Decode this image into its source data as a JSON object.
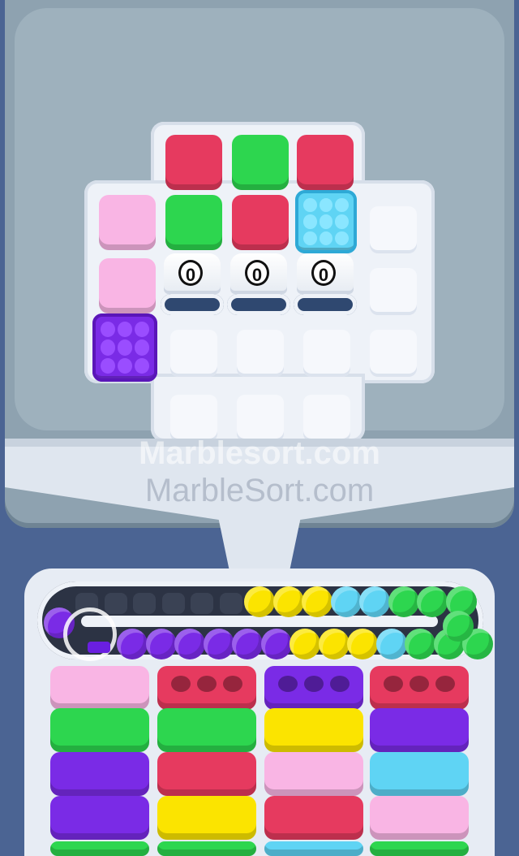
{
  "colors": {
    "red": "#e63a5f",
    "green": "#2dd64f",
    "pink": "#f9b5e4",
    "purple": "#7a2be6",
    "cyan": "#5fd4f4",
    "yellow": "#fbe400",
    "slot": "#f6f8fc"
  },
  "watermark": {
    "primary": "Marblesort.com",
    "secondary": "MarbleSort.com"
  },
  "cups": [
    {
      "count": "0"
    },
    {
      "count": "0"
    },
    {
      "count": "0"
    }
  ],
  "grid": {
    "blocks": [
      {
        "color": "red",
        "type": "block"
      },
      {
        "color": "green",
        "type": "block"
      },
      {
        "color": "red",
        "type": "block"
      },
      {
        "color": "pink",
        "type": "block"
      },
      {
        "color": "green",
        "type": "block"
      },
      {
        "color": "red",
        "type": "block"
      },
      {
        "color": "cyan",
        "type": "marble-block"
      },
      {
        "color": "pink",
        "type": "block"
      },
      {
        "color": "purple",
        "type": "marble-block"
      }
    ]
  },
  "conveyor": {
    "top_row": [
      "empty",
      "empty",
      "empty",
      "empty",
      "empty",
      "empty",
      "yellow",
      "yellow",
      "yellow",
      "cyan",
      "cyan",
      "green",
      "green",
      "green"
    ],
    "bottom_row": [
      "purple",
      "purple",
      "purple",
      "purple",
      "purple",
      "purple",
      "yellow",
      "yellow",
      "yellow",
      "cyan",
      "green",
      "green",
      "green"
    ],
    "left_marble": "purple"
  },
  "storage": {
    "columns": [
      [
        "pink",
        "green",
        "purple",
        "purple",
        "green"
      ],
      [
        "red",
        "green",
        "red",
        "yellow",
        "green"
      ],
      [
        "purple",
        "yellow",
        "pink",
        "red",
        "cyan"
      ],
      [
        "red",
        "purple",
        "cyan",
        "pink",
        "green"
      ]
    ]
  },
  "icons": [
    "marble-block-icon",
    "cup-icon",
    "conveyor-ring-icon"
  ]
}
